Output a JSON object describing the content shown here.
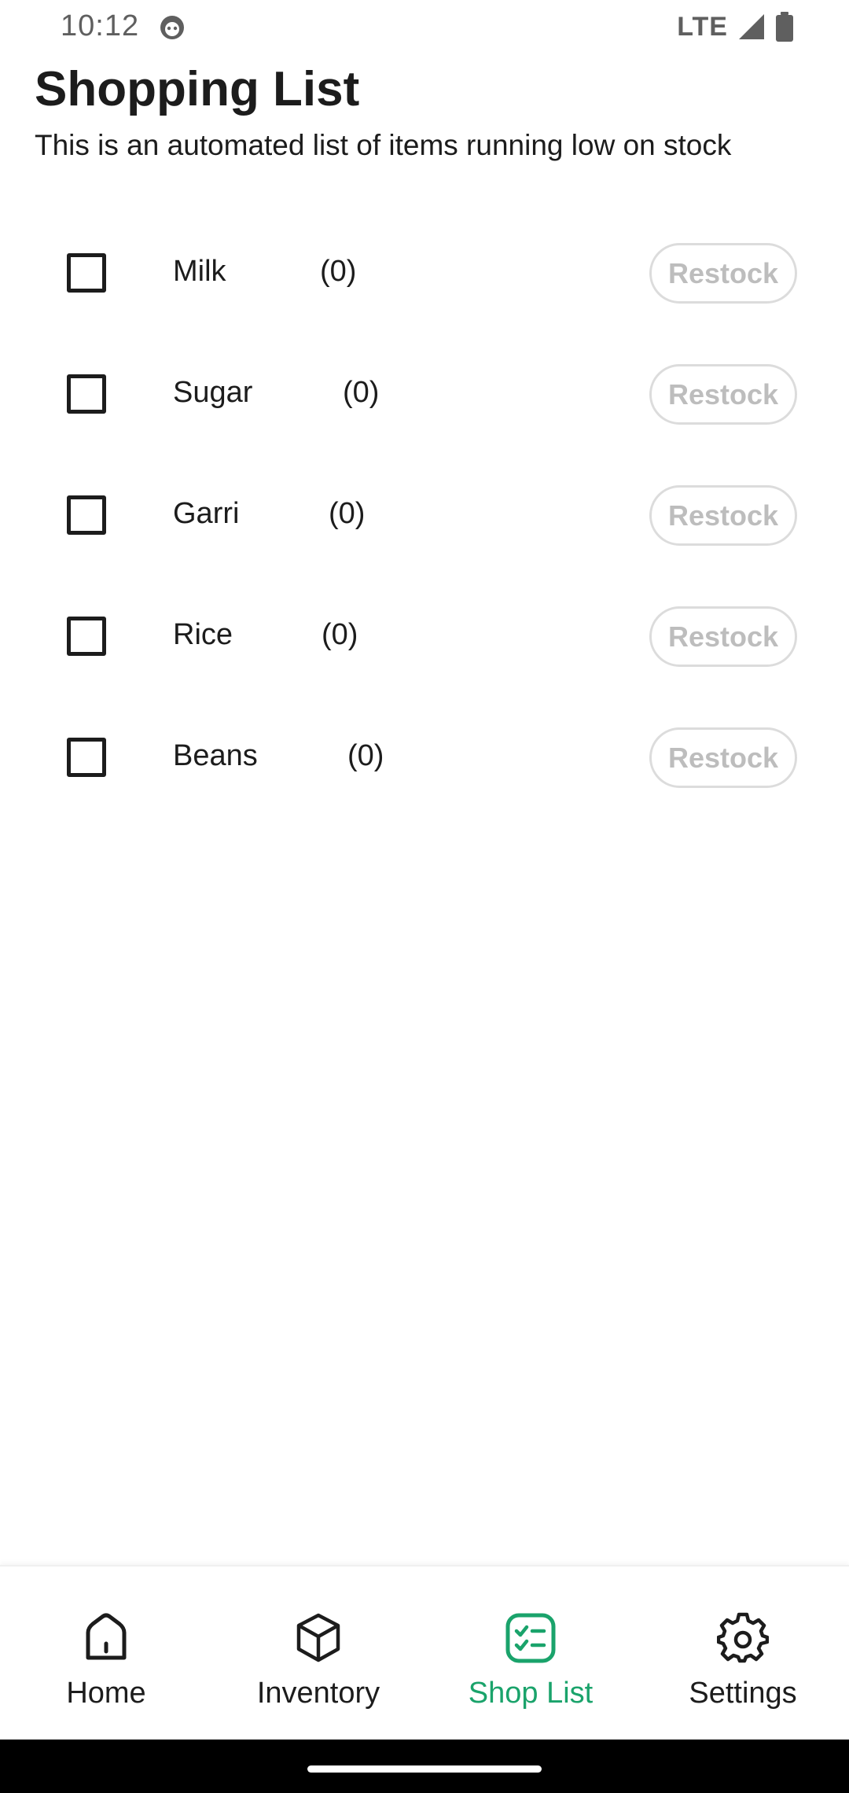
{
  "status": {
    "time": "10:12",
    "network": "LTE"
  },
  "header": {
    "title": "Shopping List",
    "subtitle": "This is an automated list of items running low on stock"
  },
  "items": [
    {
      "name": "Milk",
      "qty": "(0)",
      "restock_label": "Restock"
    },
    {
      "name": "Sugar",
      "qty": "(0)",
      "restock_label": "Restock"
    },
    {
      "name": "Garri",
      "qty": "(0)",
      "restock_label": "Restock"
    },
    {
      "name": "Rice",
      "qty": "(0)",
      "restock_label": "Restock"
    },
    {
      "name": "Beans",
      "qty": "(0)",
      "restock_label": "Restock"
    }
  ],
  "nav": {
    "items": [
      {
        "label": "Home",
        "icon": "home-icon"
      },
      {
        "label": "Inventory",
        "icon": "box-icon"
      },
      {
        "label": "Shop List",
        "icon": "checklist-icon"
      },
      {
        "label": "Settings",
        "icon": "gear-icon"
      }
    ],
    "active": "Shop List"
  },
  "colors": {
    "accent": "#1aa36b",
    "text": "#1c1c1c",
    "disabled": "#bdbdbd"
  }
}
